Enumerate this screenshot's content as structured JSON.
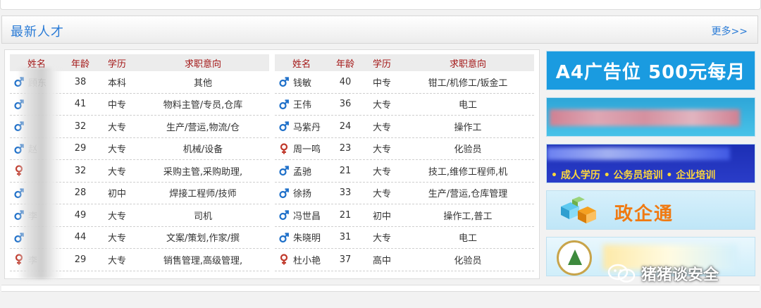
{
  "section": {
    "title": "最新人才",
    "more": "更多>>"
  },
  "table": {
    "headers": {
      "name": "姓名",
      "age": "年龄",
      "edu": "学历",
      "job": "求职意向"
    },
    "left_rows": [
      {
        "gender": "male",
        "name": "顾东",
        "age": "38",
        "edu": "本科",
        "job": "其他"
      },
      {
        "gender": "male",
        "name": "",
        "age": "41",
        "edu": "中专",
        "job": "物料主管/专员,仓库"
      },
      {
        "gender": "male",
        "name": "",
        "age": "32",
        "edu": "大专",
        "job": "生产/营运,物流/仓"
      },
      {
        "gender": "male",
        "name": "赵",
        "age": "29",
        "edu": "大专",
        "job": "机械/设备"
      },
      {
        "gender": "female",
        "name": "",
        "age": "32",
        "edu": "大专",
        "job": "采购主管,采购助理,"
      },
      {
        "gender": "male",
        "name": "",
        "age": "28",
        "edu": "初中",
        "job": "焊接工程师/技师"
      },
      {
        "gender": "male",
        "name": "李",
        "age": "49",
        "edu": "大专",
        "job": "司机"
      },
      {
        "gender": "male",
        "name": "",
        "age": "44",
        "edu": "大专",
        "job": "文案/策划,作家/撰"
      },
      {
        "gender": "female",
        "name": "李",
        "age": "29",
        "edu": "大专",
        "job": "销售管理,高级管理,"
      }
    ],
    "right_rows": [
      {
        "gender": "male",
        "name": "钱敏",
        "age": "40",
        "edu": "中专",
        "job": "钳工/机修工/钣金工"
      },
      {
        "gender": "male",
        "name": "王伟",
        "age": "36",
        "edu": "大专",
        "job": "电工"
      },
      {
        "gender": "male",
        "name": "马紫丹",
        "age": "24",
        "edu": "大专",
        "job": "操作工"
      },
      {
        "gender": "female",
        "name": "周一鸣",
        "age": "23",
        "edu": "大专",
        "job": "化验员"
      },
      {
        "gender": "male",
        "name": "孟驰",
        "age": "21",
        "edu": "大专",
        "job": "技工,维修工程师,机"
      },
      {
        "gender": "male",
        "name": "徐扬",
        "age": "33",
        "edu": "大专",
        "job": "生产/营运,仓库管理"
      },
      {
        "gender": "male",
        "name": "冯世昌",
        "age": "21",
        "edu": "初中",
        "job": "操作工,普工"
      },
      {
        "gender": "male",
        "name": "朱晓明",
        "age": "31",
        "edu": "大专",
        "job": "电工"
      },
      {
        "gender": "female",
        "name": "杜小艳",
        "age": "37",
        "edu": "高中",
        "job": "化验员"
      }
    ]
  },
  "ads": {
    "ad1": "A4广告位 500元每月",
    "ad3": "• 成人学历 • 公务员培训 • 企业培训",
    "ad4": "政企通"
  },
  "watermark": "猪猪谈安全",
  "colors": {
    "accent": "#2a7bd6",
    "header_text": "#a31515",
    "male": "#1d6fc9",
    "female": "#c0392b"
  }
}
